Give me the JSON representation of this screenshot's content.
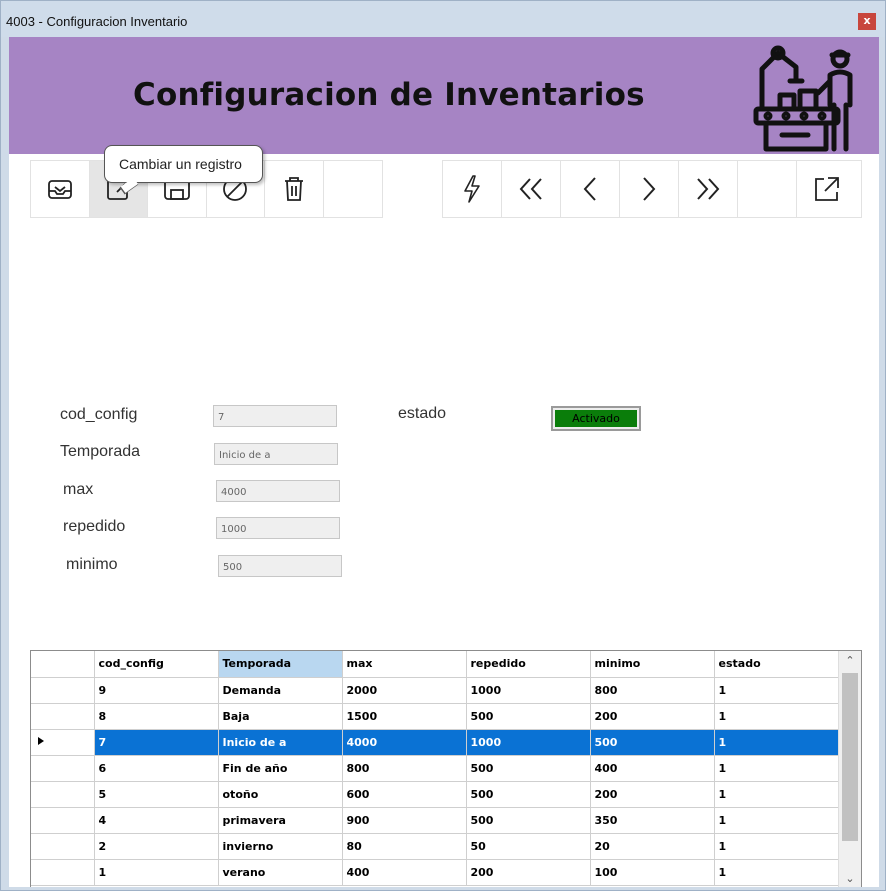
{
  "window": {
    "title": "4003 - Configuracion Inventario",
    "close_label": "x"
  },
  "header": {
    "title": "Configuracion de Inventarios"
  },
  "toolbar": {
    "left_buttons": [
      "inbox-icon",
      "edit-icon",
      "save-icon",
      "cancel-icon",
      "trash-icon",
      "empty"
    ],
    "right_buttons": [
      "lightning-icon",
      "first-record-icon",
      "previous-icon",
      "next-icon",
      "last-record-icon",
      "empty",
      "export-icon"
    ],
    "tooltip": "Cambiar un registro"
  },
  "form": {
    "cod_config": {
      "label": "cod_config",
      "value": "7"
    },
    "temporada": {
      "label": "Temporada",
      "value": "Inicio de a"
    },
    "max": {
      "label": "max",
      "value": "4000"
    },
    "repedido": {
      "label": "repedido",
      "value": "1000"
    },
    "minimo": {
      "label": "minimo",
      "value": "500"
    },
    "estado": {
      "label": "estado",
      "button": "Activado",
      "color": "#0a7d0a"
    }
  },
  "grid": {
    "columns": [
      "cod_config",
      "Temporada",
      "max",
      "repedido",
      "minimo",
      "estado"
    ],
    "selected_row": 2,
    "rows": [
      [
        "9",
        "Demanda",
        "2000",
        "1000",
        "800",
        "1"
      ],
      [
        "8",
        "Baja",
        "1500",
        "500",
        "200",
        "1"
      ],
      [
        "7",
        "Inicio de a",
        "4000",
        "1000",
        "500",
        "1"
      ],
      [
        "6",
        "Fin de año",
        "800",
        "500",
        "400",
        "1"
      ],
      [
        "5",
        "otoño",
        "600",
        "500",
        "200",
        "1"
      ],
      [
        "4",
        "primavera",
        "900",
        "500",
        "350",
        "1"
      ],
      [
        "2",
        "invierno",
        "80",
        "50",
        "20",
        "1"
      ],
      [
        "1",
        "verano",
        "400",
        "200",
        "100",
        "1"
      ]
    ],
    "colors": {
      "selected": "#0a72d4",
      "sorted_header": "#b9d7f0"
    }
  },
  "colors": {
    "banner": "#a684c4",
    "titlebar": "#cfdcea"
  }
}
